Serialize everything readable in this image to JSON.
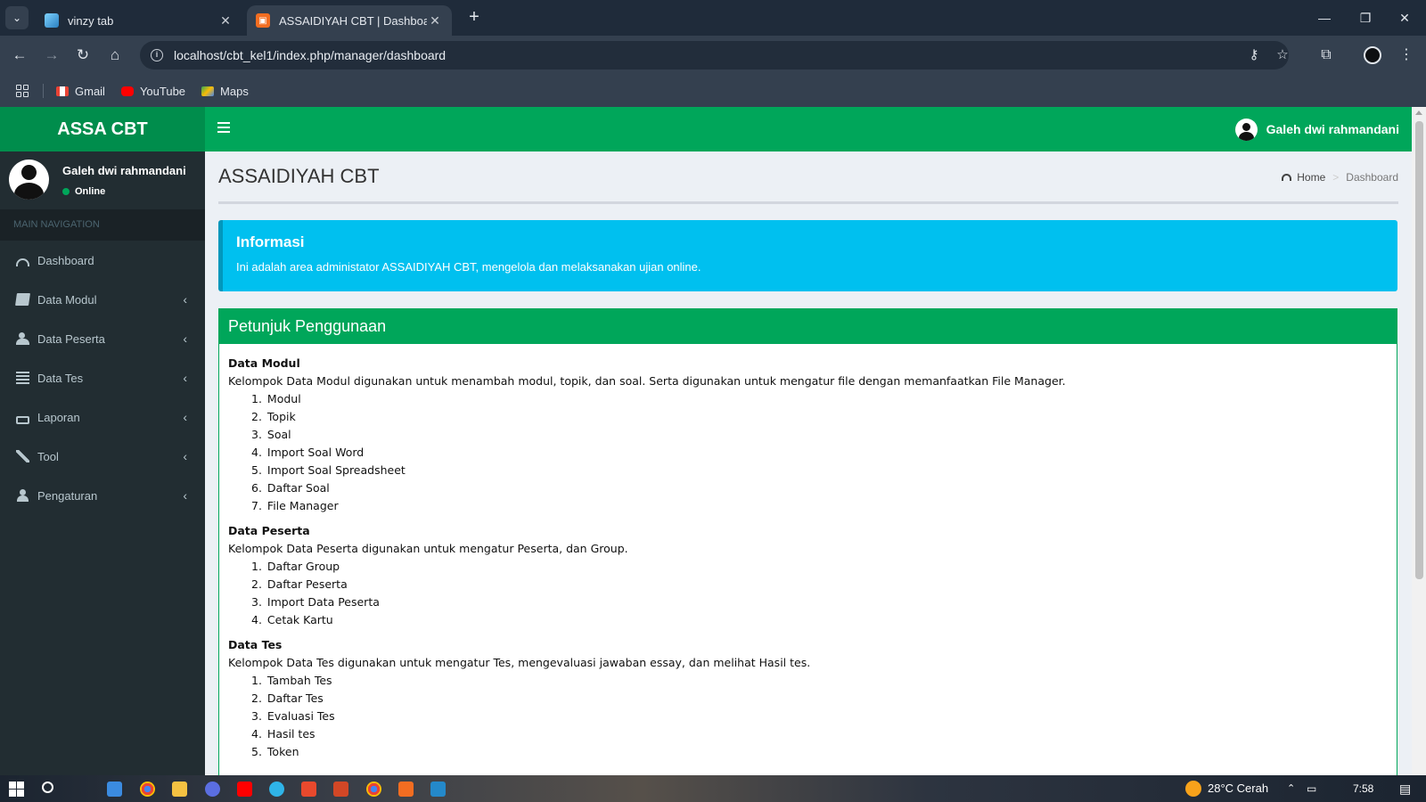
{
  "browser": {
    "tabs": [
      {
        "title": "vinzy tab",
        "active": false
      },
      {
        "title": "ASSAIDIYAH CBT | Dashboard",
        "active": true
      }
    ],
    "url": "localhost/cbt_kel1/index.php/manager/dashboard",
    "bookmarks": [
      {
        "label": "Gmail",
        "icon": "gmail-icon"
      },
      {
        "label": "YouTube",
        "icon": "youtube-icon"
      },
      {
        "label": "Maps",
        "icon": "maps-icon"
      }
    ]
  },
  "app": {
    "logo": "ASSA CBT",
    "top_user_name": "Galeh dwi rahmandani",
    "user_panel": {
      "name": "Galeh dwi rahmandani",
      "status": "Online"
    },
    "nav_header": "MAIN NAVIGATION",
    "menu": [
      {
        "label": "Dashboard",
        "icon": "dashboard-icon",
        "has_children": false
      },
      {
        "label": "Data Modul",
        "icon": "book-icon",
        "has_children": true
      },
      {
        "label": "Data Peserta",
        "icon": "users-icon",
        "has_children": true
      },
      {
        "label": "Data Tes",
        "icon": "list-icon",
        "has_children": true
      },
      {
        "label": "Laporan",
        "icon": "print-icon",
        "has_children": true
      },
      {
        "label": "Tool",
        "icon": "wrench-icon",
        "has_children": true
      },
      {
        "label": "Pengaturan",
        "icon": "user-icon",
        "has_children": true
      }
    ],
    "page_title": "ASSAIDIYAH CBT",
    "breadcrumb": {
      "home": "Home",
      "current": "Dashboard"
    },
    "callout": {
      "title": "Informasi",
      "text": "Ini adalah area administator ASSAIDIYAH CBT, mengelola dan melaksanakan ujian online."
    },
    "box_title": "Petunjuk Penggunaan",
    "sections": [
      {
        "title": "Data Modul",
        "desc": "Kelompok Data Modul digunakan untuk menambah modul, topik, dan soal. Serta digunakan untuk mengatur file dengan memanfaatkan File Manager.",
        "items": [
          "Modul",
          "Topik",
          "Soal",
          "Import Soal Word",
          "Import Soal Spreadsheet",
          "Daftar Soal",
          "File Manager"
        ]
      },
      {
        "title": "Data Peserta",
        "desc": "Kelompok Data Peserta digunakan untuk mengatur Peserta, dan Group.",
        "items": [
          "Daftar Group",
          "Daftar Peserta",
          "Import Data Peserta",
          "Cetak Kartu"
        ]
      },
      {
        "title": "Data Tes",
        "desc": "Kelompok Data Tes digunakan untuk mengatur Tes, mengevaluasi jawaban essay, dan melihat Hasil tes.",
        "items": [
          "Tambah Tes",
          "Daftar Tes",
          "Evaluasi Tes",
          "Hasil tes",
          "Token"
        ]
      }
    ]
  },
  "taskbar": {
    "weather": "28°C Cerah",
    "time": "7:58"
  },
  "colors": {
    "brand_green": "#00a65a",
    "brand_green_dark": "#008d4c",
    "sidebar_bg": "#222d32",
    "callout_info": "#00c0ef"
  }
}
